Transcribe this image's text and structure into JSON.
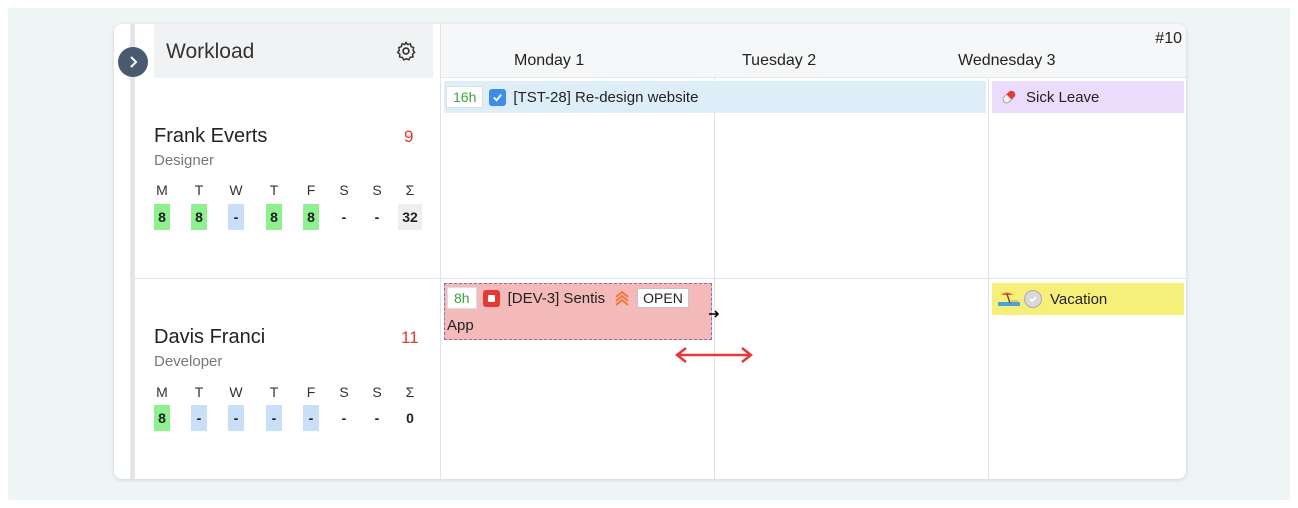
{
  "header": {
    "title": "Workload",
    "week": "#10"
  },
  "days": [
    "Monday 1",
    "Tuesday 2",
    "Wednesday 3"
  ],
  "weekday_letters": [
    "M",
    "T",
    "W",
    "T",
    "F",
    "S",
    "S",
    "Σ"
  ],
  "people": [
    {
      "name": "Frank Everts",
      "role": "Designer",
      "count": "9",
      "hours": [
        "8",
        "8",
        "-",
        "8",
        "8",
        "-",
        "-",
        "32"
      ]
    },
    {
      "name": "Davis Franci",
      "role": "Developer",
      "count": "11",
      "hours": [
        "8",
        "-",
        "-",
        "-",
        "-",
        "-",
        "-",
        "0"
      ]
    }
  ],
  "tasks": {
    "tst28": {
      "hours": "16h",
      "title": "[TST-28] Re-design website"
    },
    "sick": {
      "title": "Sick Leave"
    },
    "dev3": {
      "hours": "8h",
      "title": "[DEV-3] Sentis",
      "status": "OPEN",
      "title_cont": "App"
    },
    "vacation": {
      "title": "Vacation"
    }
  },
  "colors": {
    "accent_red": "#e53935",
    "accent_green": "#3aa53a",
    "task_blue": "#deeef8",
    "sick": "#ecdcfb",
    "dev": "#f4b9b9",
    "vacation": "#f6f07a"
  }
}
